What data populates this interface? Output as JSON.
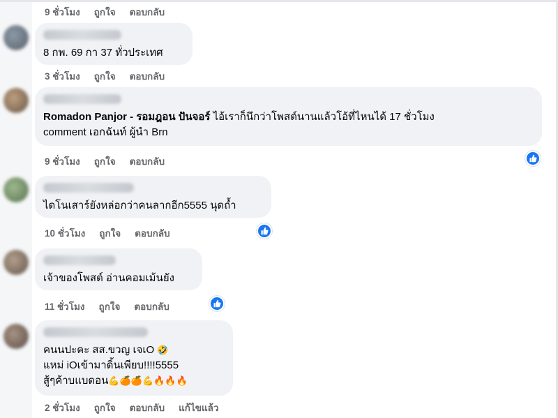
{
  "comments": [
    {
      "author_label": "",
      "text": "",
      "timestamp": "9 ชั่วโมง",
      "like_label": "ถูกใจ",
      "reply_label": "ตอบกลับ"
    },
    {
      "text": "8 กพ. 69 กา 37 ทั่วประเทศ",
      "timestamp": "3 ชั่วโมง",
      "like_label": "ถูกใจ",
      "reply_label": "ตอบกลับ"
    },
    {
      "mention": "Romadon Panjor - รอมฎอน ปันจอร์",
      "text_line1": " ไอ้เราก็นึกว่าโพสต์นานแล้วโอ้ที่ไหนได้ 17 ชั่วโมง",
      "text_line2": "comment เอกฉันท์ ผู้นำ Brn",
      "timestamp": "9 ชั่วโมง",
      "like_label": "ถูกใจ",
      "reply_label": "ตอบกลับ"
    },
    {
      "text": "ไดโนเสาร์ยังหล่อกว่าคนลากอีก5555 นุดถ้ำ",
      "timestamp": "10 ชั่วโมง",
      "like_label": "ถูกใจ",
      "reply_label": "ตอบกลับ"
    },
    {
      "text": "เจ้าของโพสต์ อ่านคอมเม้นยัง",
      "timestamp": "11 ชั่วโมง",
      "like_label": "ถูกใจ",
      "reply_label": "ตอบกลับ"
    },
    {
      "line1": "คนนปะคะ สส.ขวญ เจเO",
      "line2": "แหม่ iOเข้ามาดิ้นเพียบ!!!!5555",
      "line3": "สู้ๆค้าบแบดอน",
      "timestamp": "2 ชั่วโมง",
      "like_label": "ถูกใจ",
      "reply_label": "ตอบกลับ",
      "edited_label": "แก้ไขแล้ว"
    }
  ],
  "colors": {
    "bubble": "#f0f2f5",
    "meta_text": "#65676b",
    "like_badge": "#1877f2",
    "body_text": "#050505"
  },
  "icons": {
    "reaction": "thumbs-up-icon",
    "laugh": "rolling-laughing-emoji",
    "muscle": "flexed-biceps-emoji",
    "orange": "tangerine-emoji",
    "fire": "fire-emoji"
  }
}
